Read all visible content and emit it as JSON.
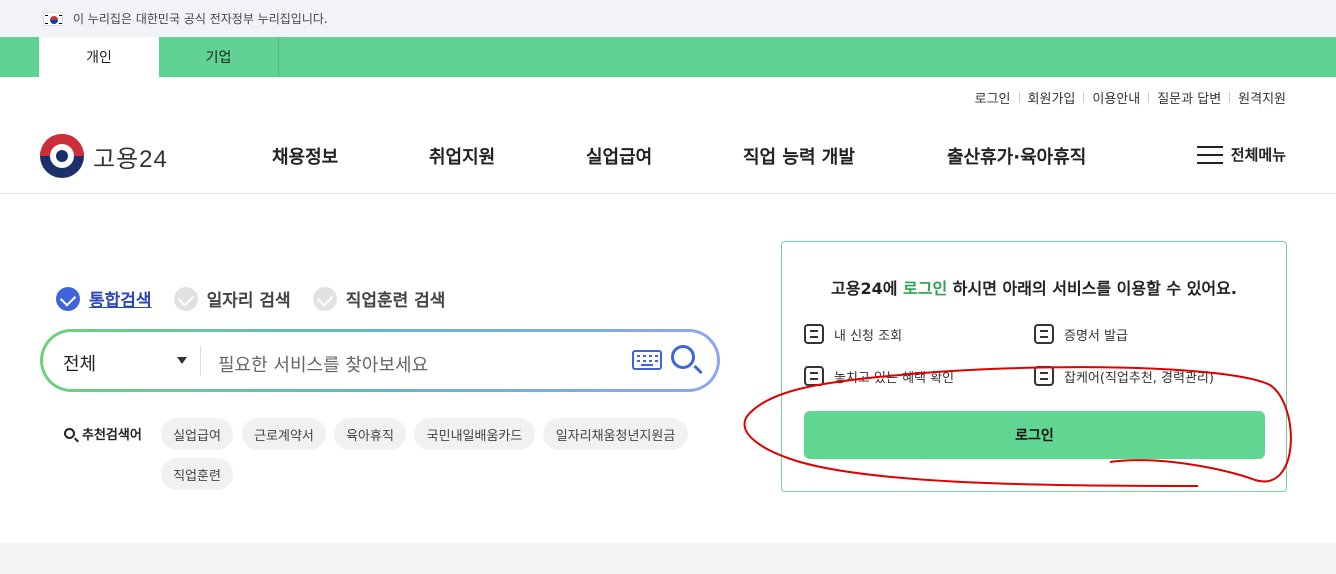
{
  "gov_banner": {
    "text": "이 누리집은 대한민국 공식 전자정부 누리집입니다."
  },
  "tabs": [
    {
      "label": "개인"
    },
    {
      "label": "기업"
    }
  ],
  "util_links": [
    "로그인",
    "회원가입",
    "이용안내",
    "질문과 답변",
    "원격지원"
  ],
  "logo": {
    "text": "고용24"
  },
  "nav": [
    "채용정보",
    "취업지원",
    "실업급여",
    "직업 능력 개발",
    "출산휴가·육아휴직"
  ],
  "menu": {
    "label": "전체메뉴"
  },
  "search": {
    "options": [
      "통합검색",
      "일자리 검색",
      "직업훈련 검색"
    ],
    "scope": "전체",
    "placeholder": "필요한 서비스를 찾아보세요"
  },
  "recommended": {
    "label": "추천검색어",
    "keywords": [
      "실업급여",
      "근로계약서",
      "육아휴직",
      "국민내일배움카드",
      "일자리채움청년지원금",
      "직업훈련"
    ]
  },
  "login_panel": {
    "title_pre": "고용24에 ",
    "title_highlight": "로그인",
    "title_post": " 하시면 아래의 서비스를 이용할 수 있어요.",
    "services": [
      "내 신청 조회",
      "증명서 발급",
      "놓치고 있는 혜택 확인",
      "잡케어(직업추천, 경력관리)"
    ],
    "button": "로그인"
  },
  "colors": {
    "green": "#60d394",
    "blue": "#3f65d8",
    "highlight": "#2aa34f",
    "annotation": "#e00000"
  }
}
